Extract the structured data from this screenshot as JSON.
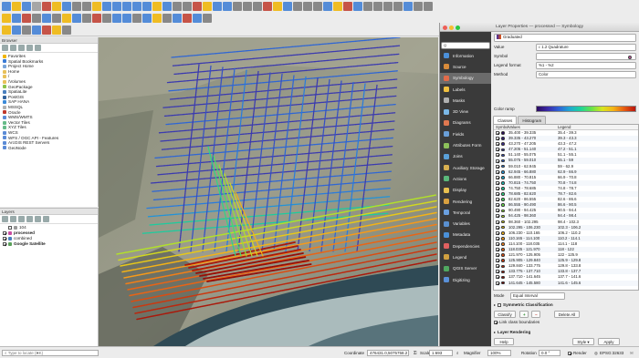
{
  "toolbar": {
    "row1_colors": [
      "#3a7bd5",
      "#f0b400",
      "#3a7bd5",
      "#9a9a9a",
      "#c0392b",
      "#f0b400",
      "#3a7bd5",
      "#777",
      "#777",
      "#f0b400",
      "#3a7bd5",
      "#3a7bd5",
      "#3a7bd5",
      "#3a7bd5",
      "#3a7bd5",
      "#f0b400",
      "#3a7bd5",
      "#777",
      "#777",
      "#c0392b",
      "#f0b400",
      "#3a7bd5",
      "#3a7bd5",
      "#777",
      "#777",
      "#777",
      "#c0392b",
      "#f0b400",
      "#3a7bd5",
      "#777",
      "#777",
      "#777",
      "#3a7bd5",
      "#f0b400",
      "#c0392b",
      "#3a7bd5",
      "#777",
      "#777",
      "#777",
      "#777",
      "#3a7bd5",
      "#777",
      "#777"
    ],
    "row2_colors": [
      "#f0b400",
      "#3a7bd5",
      "#c0392b",
      "#777",
      "#3a7bd5",
      "#777",
      "#f0b400",
      "#3a7bd5",
      "#777",
      "#c0392b",
      "#777",
      "#3a7bd5",
      "#3a7bd5",
      "#777",
      "#3a7bd5",
      "#f0b400",
      "#777",
      "#3a7bd5",
      "#c0392b",
      "#3a7bd5",
      "#777"
    ],
    "row3_colors": [
      "#f0b400",
      "#3a7bd5",
      "#777",
      "#3a7bd5",
      "#c0392b",
      "#f0b400",
      "#777"
    ]
  },
  "browser": {
    "title": "Browser",
    "items": [
      {
        "label": "Favorites",
        "icon": "star-icon",
        "color": "#f0b400"
      },
      {
        "label": "Spatial Bookmarks",
        "icon": "bookmark-icon",
        "color": "#3a7bd5"
      },
      {
        "label": "Project Home",
        "icon": "home-icon",
        "color": "#7aa5d8"
      },
      {
        "label": "Home",
        "icon": "folder-icon",
        "color": "#e8c15a"
      },
      {
        "label": "/",
        "icon": "folder-icon",
        "color": "#e8c15a"
      },
      {
        "label": "/Volumes",
        "icon": "folder-icon",
        "color": "#e8c15a"
      },
      {
        "label": "GeoPackage",
        "icon": "geopackage-icon",
        "color": "#8bc34a"
      },
      {
        "label": "SpatiaLite",
        "icon": "spatialite-icon",
        "color": "#4a7fbd"
      },
      {
        "label": "PostGIS",
        "icon": "postgis-icon",
        "color": "#33639c"
      },
      {
        "label": "SAP HANA",
        "icon": "database-icon",
        "color": "#3b8ad8"
      },
      {
        "label": "MSSQL",
        "icon": "database-icon",
        "color": "#b0b0b0"
      },
      {
        "label": "Oracle",
        "icon": "database-icon",
        "color": "#c0392b"
      },
      {
        "label": "WMS/WMTS",
        "icon": "globe-icon",
        "color": "#5b8bd6"
      },
      {
        "label": "Vector Tiles",
        "icon": "grid-icon",
        "color": "#6b8"
      },
      {
        "label": "XYZ Tiles",
        "icon": "grid-icon",
        "color": "#6b8"
      },
      {
        "label": "WCS",
        "icon": "globe-icon",
        "color": "#5b8bd6"
      },
      {
        "label": "WFS / OGC API - Features",
        "icon": "globe-icon",
        "color": "#5b8bd6"
      },
      {
        "label": "ArcGIS REST Servers",
        "icon": "globe-icon",
        "color": "#5b8bd6"
      },
      {
        "label": "GeoNode",
        "icon": "globe-icon",
        "color": "#5b8bd6"
      }
    ]
  },
  "layers": {
    "title": "Layers",
    "items": [
      {
        "label": "104",
        "checked": false,
        "bold": false,
        "indent": 1,
        "swatch": "#9a9a9a"
      },
      {
        "label": "processed",
        "checked": true,
        "bold": true,
        "indent": 0,
        "swatch": "#c94da0"
      },
      {
        "label": "combined",
        "checked": true,
        "bold": false,
        "indent": 0,
        "swatch": "#4a7fbd"
      },
      {
        "label": "Google Satellite",
        "checked": true,
        "bold": true,
        "indent": 0,
        "swatch": "#5aa05a"
      }
    ]
  },
  "dialog": {
    "title": "Layer Properties — processed — Symbology",
    "search_placeholder": "Q",
    "nav": [
      {
        "label": "Information",
        "color": "#4b8fd8"
      },
      {
        "label": "Source",
        "color": "#d88b3a"
      },
      {
        "label": "Symbology",
        "color": "#e26b4a"
      },
      {
        "label": "Labels",
        "color": "#f0c040"
      },
      {
        "label": "Masks",
        "color": "#b0b0b0"
      },
      {
        "label": "3D View",
        "color": "#7ab8e8"
      },
      {
        "label": "Diagrams",
        "color": "#e07850"
      },
      {
        "label": "Fields",
        "color": "#6a9fd8"
      },
      {
        "label": "Attributes Form",
        "color": "#8cc05a"
      },
      {
        "label": "Joins",
        "color": "#5aa0d8"
      },
      {
        "label": "Auxiliary Storage",
        "color": "#d8b050"
      },
      {
        "label": "Actions",
        "color": "#5ab87a"
      },
      {
        "label": "Display",
        "color": "#e8c050"
      },
      {
        "label": "Rendering",
        "color": "#d8a040"
      },
      {
        "label": "Temporal",
        "color": "#6aa0e0"
      },
      {
        "label": "Variables",
        "color": "#5a90d0"
      },
      {
        "label": "Metadata",
        "color": "#4a90d8"
      },
      {
        "label": "Dependencies",
        "color": "#e06060"
      },
      {
        "label": "Legend",
        "color": "#d0a040"
      },
      {
        "label": "QGIS Server",
        "color": "#50a860"
      },
      {
        "label": "Digitizing",
        "color": "#5a90d8"
      }
    ],
    "selected_nav": "Symbology",
    "renderer": "Graduated",
    "value_label": "Value",
    "value": "1.2 Quadrature",
    "symbol_label": "Symbol",
    "legend_format_label": "Legend format",
    "legend_format": "%1 - %2",
    "method_label": "Method",
    "method": "Color",
    "color_ramp_label": "Color ramp",
    "tabs": [
      "Classes",
      "Histogram"
    ],
    "selected_tab": "Classes",
    "columns": [
      "Symbol",
      "Values",
      "Legend"
    ],
    "classes": [
      {
        "values": "35.400 - 39.335",
        "legend": "35.4 - 39.3",
        "color": "#2b0a5e"
      },
      {
        "values": "39.335 - 43.270",
        "legend": "39.3 - 43.3",
        "color": "#331a78"
      },
      {
        "values": "43.270 - 47.205",
        "legend": "43.3 - 47.2",
        "color": "#3a2a95"
      },
      {
        "values": "47.205 - 51.140",
        "legend": "47.2 - 51.1",
        "color": "#3b3aaf"
      },
      {
        "values": "51.140 - 55.075",
        "legend": "51.1 - 55.1",
        "color": "#3650c4"
      },
      {
        "values": "55.075 - 59.010",
        "legend": "55.1 - 59",
        "color": "#2f66d4"
      },
      {
        "values": "59.010 - 62.945",
        "legend": "59 - 62.9",
        "color": "#2a7cdc"
      },
      {
        "values": "62.945 - 66.880",
        "legend": "62.9 - 66.9",
        "color": "#2293d8"
      },
      {
        "values": "66.880 - 70.815",
        "legend": "66.9 - 70.8",
        "color": "#1ba8cc"
      },
      {
        "values": "70.815 - 74.750",
        "legend": "70.8 - 74.8",
        "color": "#18bcb8"
      },
      {
        "values": "74.750 - 78.685",
        "legend": "74.8 - 78.7",
        "color": "#1ccc9e"
      },
      {
        "values": "78.685 - 82.620",
        "legend": "78.7 - 82.6",
        "color": "#2ad884"
      },
      {
        "values": "82.620 - 86.555",
        "legend": "82.6 - 86.6",
        "color": "#45e066"
      },
      {
        "values": "86.555 - 90.490",
        "legend": "86.6 - 90.5",
        "color": "#68e34c"
      },
      {
        "values": "90.490 - 94.425",
        "legend": "90.5 - 94.4",
        "color": "#8ee338"
      },
      {
        "values": "94.425 - 98.360",
        "legend": "94.4 - 98.4",
        "color": "#b2e02a"
      },
      {
        "values": "98.360 - 102.295",
        "legend": "98.4 - 102.3",
        "color": "#d2d81f"
      },
      {
        "values": "102.295 - 106.230",
        "legend": "102.3 - 106.2",
        "color": "#e8c818"
      },
      {
        "values": "106.230 - 110.165",
        "legend": "106.2 - 110.2",
        "color": "#f4b216"
      },
      {
        "values": "110.165 - 114.100",
        "legend": "110.2 - 114.1",
        "color": "#f89a18"
      },
      {
        "values": "114.100 - 118.035",
        "legend": "114.1 - 118",
        "color": "#f47f16"
      },
      {
        "values": "118.035 - 121.970",
        "legend": "118 - 122",
        "color": "#ea6414"
      },
      {
        "values": "121.970 - 125.905",
        "legend": "122 - 125.9",
        "color": "#dc4c10"
      },
      {
        "values": "125.905 - 129.840",
        "legend": "125.9 - 129.8",
        "color": "#cc380e"
      },
      {
        "values": "129.840 - 133.775",
        "legend": "129.8 - 133.8",
        "color": "#bc260c"
      },
      {
        "values": "133.775 - 137.710",
        "legend": "133.8 - 137.7",
        "color": "#aa180a"
      },
      {
        "values": "137.710 - 141.645",
        "legend": "137.7 - 141.6",
        "color": "#960e08"
      },
      {
        "values": "141.645 - 145.580",
        "legend": "141.6 - 145.6",
        "color": "#800606"
      }
    ],
    "mode_label": "Mode",
    "mode": "Equal Interval",
    "symmetric_label": "Symmetric Classification",
    "classify_label": "Classify",
    "delete_all_label": "Delete All",
    "link_label": "Link class boundaries",
    "layer_rendering_label": "Layer Rendering",
    "help_label": "Help",
    "style_label": "Style",
    "apply_label": "Apply"
  },
  "statusbar": {
    "locate_placeholder": "Type to locate (⌘K)",
    "coordinate_label": "Coordinate",
    "coordinate": "476431.0,5075758.2",
    "scale_label": "Scale",
    "scale": "1:693",
    "magnifier_label": "Magnifier",
    "magnifier": "100%",
    "rotation_label": "Rotation",
    "rotation": "0.0 °",
    "render_label": "Render",
    "crs": "EPSG:32633"
  }
}
